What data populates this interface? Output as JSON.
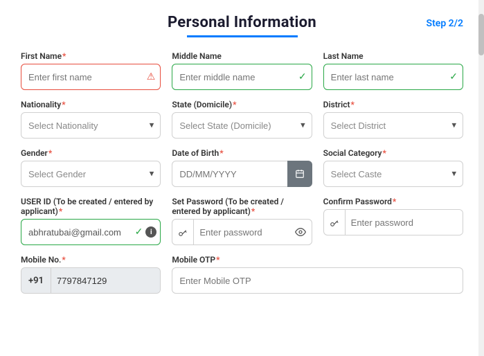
{
  "header": {
    "title": "Personal Information",
    "step": "Step 2/2",
    "underline_color": "#007bff"
  },
  "form": {
    "fields": {
      "first_name": {
        "label": "First Name",
        "required": true,
        "placeholder": "Enter first name",
        "state": "error"
      },
      "middle_name": {
        "label": "Middle Name",
        "required": false,
        "placeholder": "Enter middle name",
        "state": "success"
      },
      "last_name": {
        "label": "Last Name",
        "required": false,
        "placeholder": "Enter last name",
        "state": "success"
      },
      "nationality": {
        "label": "Nationality",
        "required": true,
        "placeholder": "Select Nationality"
      },
      "state_domicile": {
        "label": "State (Domicile)",
        "required": true,
        "placeholder": "Select State (Domicile)"
      },
      "district": {
        "label": "District",
        "required": true,
        "placeholder": "Select District"
      },
      "gender": {
        "label": "Gender",
        "required": true,
        "placeholder": "Select Gender"
      },
      "dob": {
        "label": "Date of Birth",
        "required": true,
        "placeholder": "DD/MM/YYYY"
      },
      "social_category": {
        "label": "Social Category",
        "required": true,
        "placeholder": "Select Caste"
      },
      "user_id": {
        "label": "USER ID (To be created / entered by applicant)",
        "required": true,
        "value": "abhratubai@gmail.com",
        "state": "success"
      },
      "password": {
        "label": "Set Password (To be created / entered by applicant)",
        "required": true,
        "placeholder": "Enter password"
      },
      "confirm_password": {
        "label": "Confirm Password",
        "required": true,
        "placeholder": "Enter password"
      },
      "mobile_no": {
        "label": "Mobile No.",
        "required": true,
        "prefix": "+91",
        "value": "7797847129"
      },
      "mobile_otp": {
        "label": "Mobile OTP",
        "required": true,
        "placeholder": "Enter Mobile OTP"
      }
    }
  }
}
